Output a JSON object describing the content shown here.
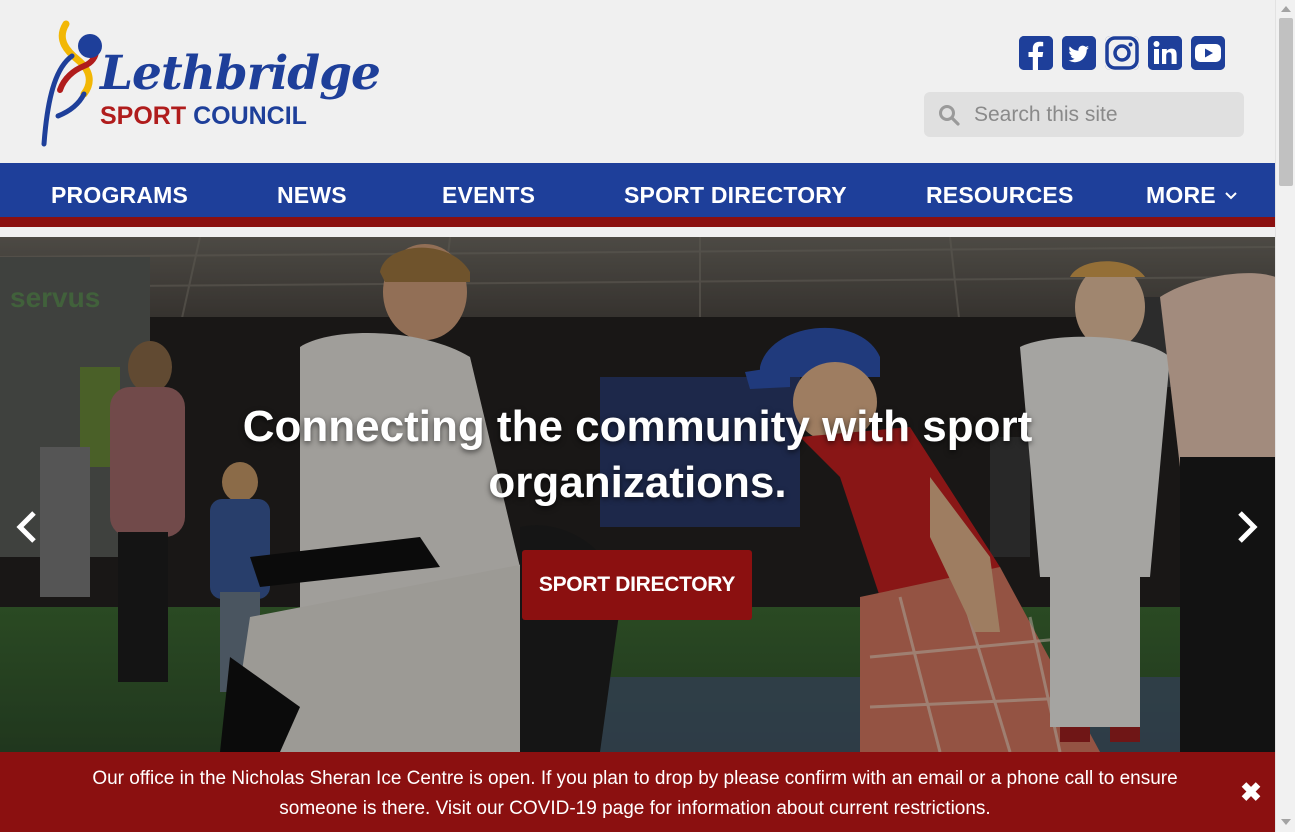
{
  "header": {
    "logo": {
      "line1": "Lethbridge",
      "line2_part1": "SPORT",
      "line2_part2": "COUNCIL"
    },
    "social": [
      {
        "name": "facebook-icon",
        "glyph": "f"
      },
      {
        "name": "twitter-icon",
        "glyph": "t"
      },
      {
        "name": "instagram-icon",
        "glyph": "ig"
      },
      {
        "name": "linkedin-icon",
        "glyph": "in"
      },
      {
        "name": "youtube-icon",
        "glyph": "▶"
      }
    ],
    "search": {
      "placeholder": "Search this site",
      "value": ""
    }
  },
  "nav": {
    "items": [
      {
        "label": "PROGRAMS"
      },
      {
        "label": "NEWS"
      },
      {
        "label": "EVENTS"
      },
      {
        "label": "SPORT DIRECTORY"
      },
      {
        "label": "RESOURCES"
      },
      {
        "label": "MORE"
      }
    ]
  },
  "hero": {
    "title": "Connecting the community with sport organizations.",
    "button_label": "SPORT DIRECTORY"
  },
  "alert": {
    "text": "Our office in the Nicholas Sheran Ice Centre is open. If you plan to drop by please confirm with an email or a phone call to ensure someone is there. Visit our COVID-19 page for information about current restrictions.",
    "close_glyph": "✖"
  },
  "colors": {
    "brand_blue": "#1e3f9a",
    "brand_red": "#8b1010",
    "logo_gold": "#f2b705"
  }
}
